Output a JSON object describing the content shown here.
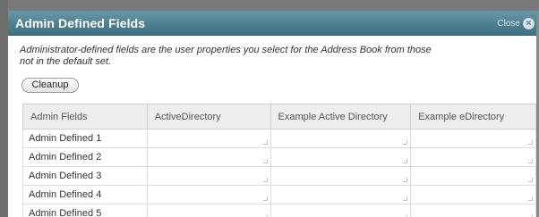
{
  "dialog": {
    "title": "Admin Defined Fields",
    "close_label": "Close",
    "close_icon": "×",
    "description": "Administrator-defined fields are the user properties you select for the Address Book from those not in the default set.",
    "cleanup_label": "Cleanup"
  },
  "table": {
    "columns": [
      "Admin Fields",
      "ActiveDirectory",
      "Example Active Directory",
      "Example eDirectory"
    ],
    "rows": [
      {
        "label": "Admin Defined 1"
      },
      {
        "label": "Admin Defined 2"
      },
      {
        "label": "Admin Defined 3"
      },
      {
        "label": "Admin Defined 4"
      },
      {
        "label": "Admin Defined 5"
      }
    ]
  },
  "colors": {
    "title_bar": "#4d7f91",
    "title_text": "#ffffff",
    "header_bg": "#eeeeee"
  }
}
